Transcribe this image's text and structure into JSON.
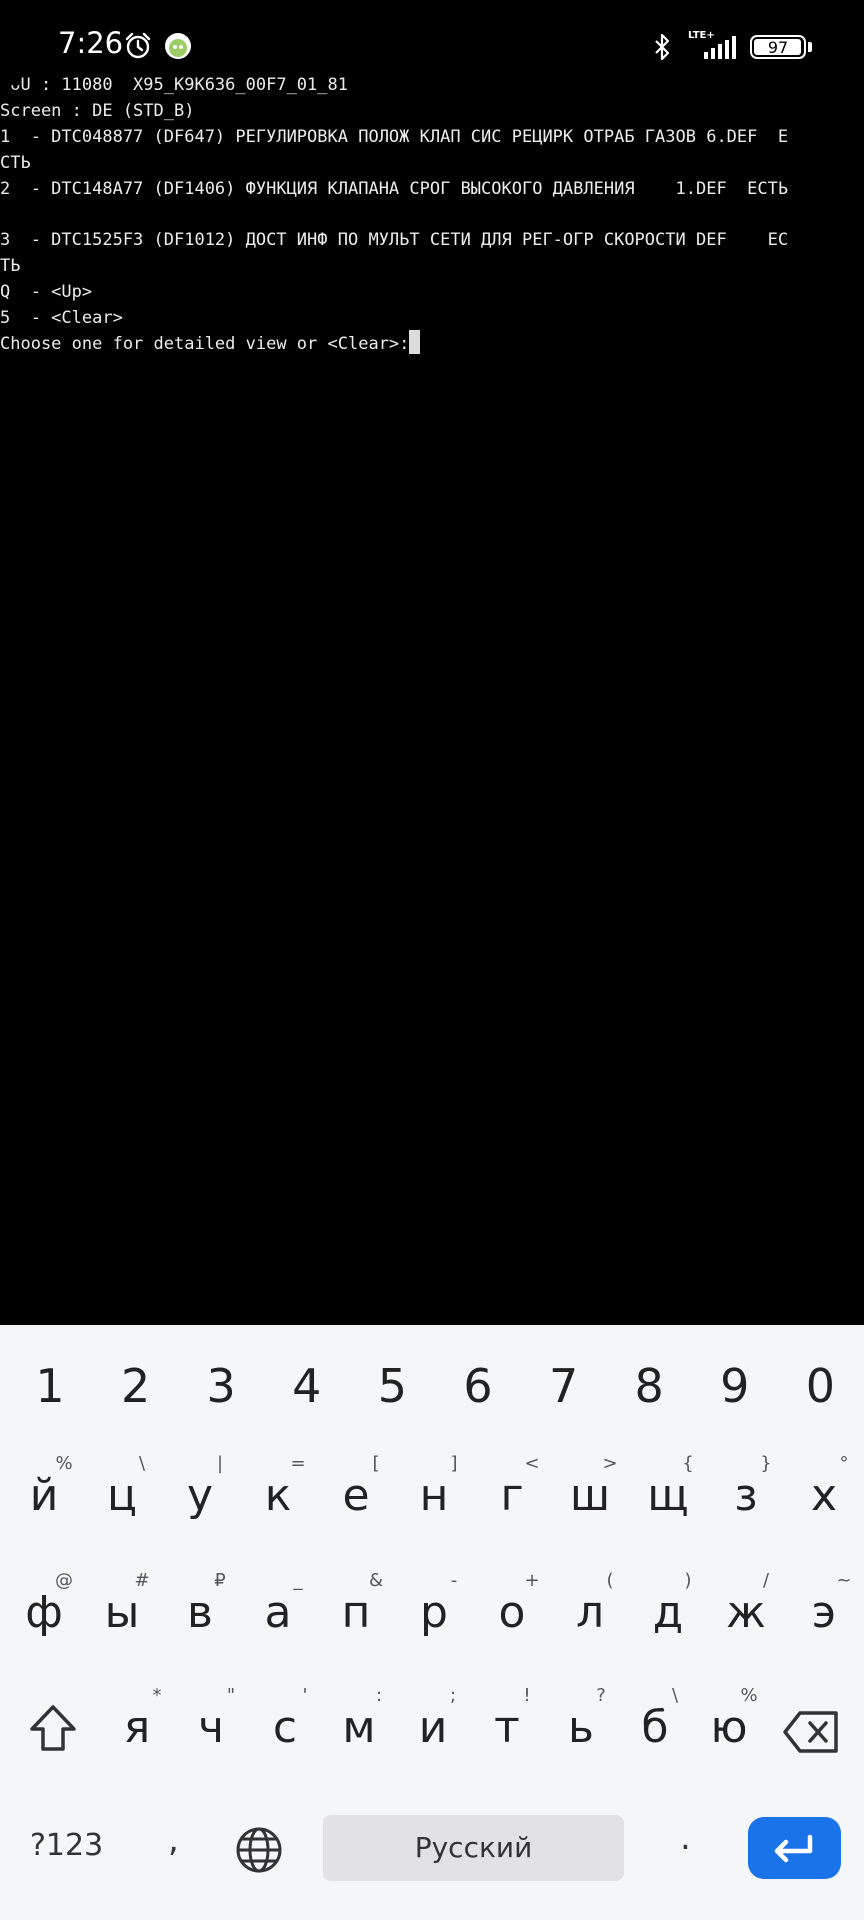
{
  "status_bar": {
    "time": "7:26",
    "network": "LTE+",
    "battery": "97",
    "battery_level": 0.97,
    "icons": [
      "alarm-icon",
      "app-notification-icon",
      "bluetooth-icon",
      "signal-icon",
      "battery-icon"
    ]
  },
  "terminal": {
    "lines": [
      " ᴗU : 11080  X95_K9K636_00F7_01_81",
      "Screen : DE (STD_B)",
      "1  - DTC048877 (DF647) РЕГУЛИРОВКА ПОЛОЖ КЛАП СИС РЕЦИРК ОТРАБ ГАЗОВ 6.DEF  Е",
      "СТЬ",
      "2  - DTC148A77 (DF1406) ФУНКЦИЯ КЛАПАНА СРОГ ВЫСОКОГО ДАВЛЕНИЯ    1.DEF  ЕСТЬ",
      "",
      "3  - DTC1525F3 (DF1012) ДОСТ ИНФ ПО МУЛЬТ СЕТИ ДЛЯ РЕГ-ОГР СКОРОСТИ DEF    ЕС",
      "ТЬ",
      "Q  - <Up>",
      "5  - <Clear>",
      "Choose one for detailed view or <Clear>:"
    ]
  },
  "keyboard": {
    "digits": [
      "1",
      "2",
      "3",
      "4",
      "5",
      "6",
      "7",
      "8",
      "9",
      "0"
    ],
    "row1": {
      "letters": [
        "й",
        "ц",
        "у",
        "к",
        "е",
        "н",
        "г",
        "ш",
        "щ",
        "з",
        "х"
      ],
      "hints": [
        "%",
        "\\",
        "|",
        "=",
        "[",
        "]",
        "<",
        ">",
        "{",
        "}",
        "°"
      ]
    },
    "row2": {
      "letters": [
        "ф",
        "ы",
        "в",
        "а",
        "п",
        "р",
        "о",
        "л",
        "д",
        "ж",
        "э"
      ],
      "hints": [
        "@",
        "#",
        "₽",
        "_",
        "&",
        "-",
        "+",
        "(",
        ")",
        "/",
        "~"
      ]
    },
    "row3": {
      "letters": [
        "я",
        "ч",
        "с",
        "м",
        "и",
        "т",
        "ь",
        "б",
        "ю"
      ],
      "hints": [
        "*",
        "\"",
        "'",
        ":",
        ";",
        "!",
        "?",
        "\\",
        "%"
      ]
    },
    "symbols_label": "?123",
    "comma": ",",
    "space_label": "Русский",
    "period": ".",
    "accent_color": "#1a73e8"
  }
}
